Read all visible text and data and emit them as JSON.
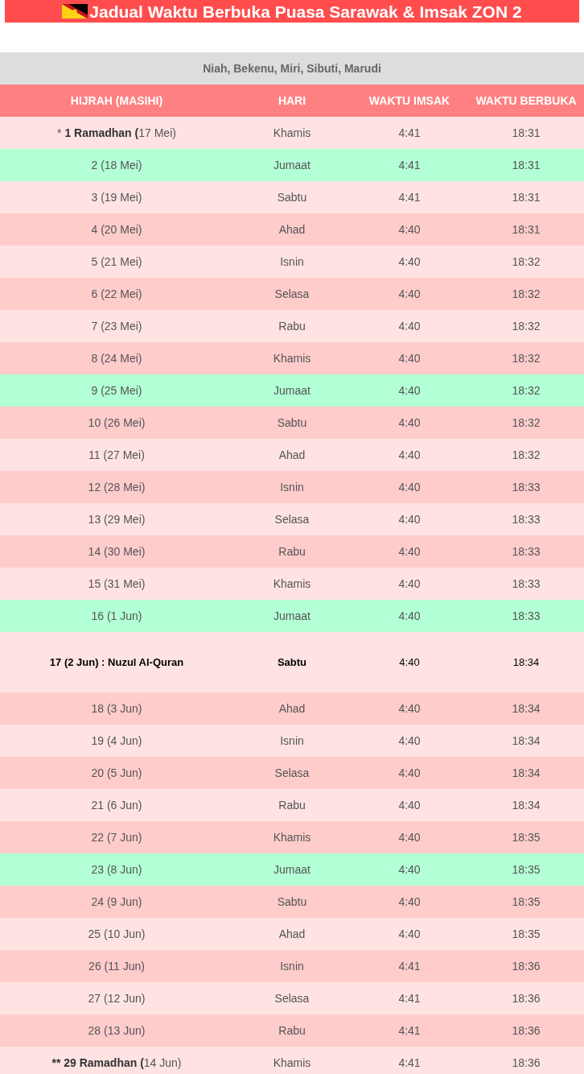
{
  "title": "Jadual Waktu Berbuka Puasa Sarawak & Imsak ZON 2",
  "zone_areas": "Niah, Bekenu, Miri, Sibuti, Marudi",
  "columns": [
    "HIJRAH (MASIHI)",
    "HARI",
    "WAKTU IMSAK",
    "WAKTU BERBUKA"
  ],
  "rows": [
    {
      "hijrah": "* **1 Ramadhan (**17 Mei)",
      "hari": "Khamis",
      "imsak": "4:41",
      "berbuka": "18:31",
      "color": "#ffe3e3",
      "emphasized": false
    },
    {
      "hijrah": "2 (18 Mei)",
      "hari": "Jumaat",
      "imsak": "4:41",
      "berbuka": "18:31",
      "color": "#b3ffd6",
      "emphasized": false
    },
    {
      "hijrah": "3 (19 Mei)",
      "hari": "Sabtu",
      "imsak": "4:41",
      "berbuka": "18:31",
      "color": "#ffe3e3",
      "emphasized": false
    },
    {
      "hijrah": "4 (20 Mei)",
      "hari": "Ahad",
      "imsak": "4:40",
      "berbuka": "18:31",
      "color": "#ffcccc",
      "emphasized": false
    },
    {
      "hijrah": "5 (21 Mei)",
      "hari": "Isnin",
      "imsak": "4:40",
      "berbuka": "18:32",
      "color": "#ffe3e3",
      "emphasized": false
    },
    {
      "hijrah": "6 (22 Mei)",
      "hari": "Selasa",
      "imsak": "4:40",
      "berbuka": "18:32",
      "color": "#ffcccc",
      "emphasized": false
    },
    {
      "hijrah": "7 (23 Mei)",
      "hari": "Rabu",
      "imsak": "4:40",
      "berbuka": "18:32",
      "color": "#ffe3e3",
      "emphasized": false
    },
    {
      "hijrah": "8 (24 Mei)",
      "hari": "Khamis",
      "imsak": "4:40",
      "berbuka": "18:32",
      "color": "#ffcccc",
      "emphasized": false
    },
    {
      "hijrah": "9 (25 Mei)",
      "hari": "Jumaat",
      "imsak": "4:40",
      "berbuka": "18:32",
      "color": "#b3ffd6",
      "emphasized": false
    },
    {
      "hijrah": "10 (26 Mei)",
      "hari": "Sabtu",
      "imsak": "4:40",
      "berbuka": "18:32",
      "color": "#ffcccc",
      "emphasized": false
    },
    {
      "hijrah": "11 (27 Mei)",
      "hari": "Ahad",
      "imsak": "4:40",
      "berbuka": "18:32",
      "color": "#ffe3e3",
      "emphasized": false
    },
    {
      "hijrah": "12 (28 Mei)",
      "hari": "Isnin",
      "imsak": "4:40",
      "berbuka": "18:33",
      "color": "#ffcccc",
      "emphasized": false
    },
    {
      "hijrah": "13 (29 Mei)",
      "hari": "Selasa",
      "imsak": "4:40",
      "berbuka": "18:33",
      "color": "#ffe3e3",
      "emphasized": false
    },
    {
      "hijrah": "14 (30 Mei)",
      "hari": "Rabu",
      "imsak": "4:40",
      "berbuka": "18:33",
      "color": "#ffcccc",
      "emphasized": false
    },
    {
      "hijrah": "15 (31 Mei)",
      "hari": "Khamis",
      "imsak": "4:40",
      "berbuka": "18:33",
      "color": "#ffe3e3",
      "emphasized": false
    },
    {
      "hijrah": "16 (1 Jun)",
      "hari": "Jumaat",
      "imsak": "4:40",
      "berbuka": "18:33",
      "color": "#b3ffd6",
      "emphasized": false
    },
    {
      "hijrah": "17 (2 Jun) : Nuzul Al-Quran",
      "hari": "Sabtu",
      "imsak": "4:40",
      "berbuka": "18:34",
      "color": "#ffe3e3",
      "emphasized": true
    },
    {
      "hijrah": "18 (3 Jun)",
      "hari": "Ahad",
      "imsak": "4:40",
      "berbuka": "18:34",
      "color": "#ffcccc",
      "emphasized": false
    },
    {
      "hijrah": "19 (4 Jun)",
      "hari": "Isnin",
      "imsak": "4:40",
      "berbuka": "18:34",
      "color": "#ffe3e3",
      "emphasized": false
    },
    {
      "hijrah": "20 (5 Jun)",
      "hari": "Selasa",
      "imsak": "4:40",
      "berbuka": "18:34",
      "color": "#ffcccc",
      "emphasized": false
    },
    {
      "hijrah": "21 (6 Jun)",
      "hari": "Rabu",
      "imsak": "4:40",
      "berbuka": "18:34",
      "color": "#ffe3e3",
      "emphasized": false
    },
    {
      "hijrah": "22 (7 Jun)",
      "hari": "Khamis",
      "imsak": "4:40",
      "berbuka": "18:35",
      "color": "#ffcccc",
      "emphasized": false
    },
    {
      "hijrah": "23 (8 Jun)",
      "hari": "Jumaat",
      "imsak": "4:40",
      "berbuka": "18:35",
      "color": "#b3ffd6",
      "emphasized": false
    },
    {
      "hijrah": "24 (9 Jun)",
      "hari": "Sabtu",
      "imsak": "4:40",
      "berbuka": "18:35",
      "color": "#ffcccc",
      "emphasized": false
    },
    {
      "hijrah": "25 (10 Jun)",
      "hari": "Ahad",
      "imsak": "4:40",
      "berbuka": "18:35",
      "color": "#ffe3e3",
      "emphasized": false
    },
    {
      "hijrah": "26 (11 Jun)",
      "hari": "Isnin",
      "imsak": "4:41",
      "berbuka": "18:36",
      "color": "#ffcccc",
      "emphasized": false
    },
    {
      "hijrah": "27 (12 Jun)",
      "hari": "Selasa",
      "imsak": "4:41",
      "berbuka": "18:36",
      "color": "#ffe3e3",
      "emphasized": false
    },
    {
      "hijrah": "28 (13 Jun)",
      "hari": "Rabu",
      "imsak": "4:41",
      "berbuka": "18:36",
      "color": "#ffcccc",
      "emphasized": false
    },
    {
      "hijrah": "**** 29 Ramadhan (**14 Jun)",
      "hari": "Khamis",
      "imsak": "4:41",
      "berbuka": "18:36",
      "color": "#ffe3e3",
      "emphasized": false
    }
  ]
}
